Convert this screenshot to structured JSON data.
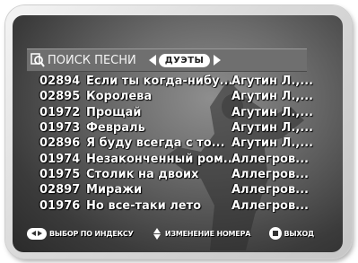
{
  "header": {
    "title": "ПОИСК ПЕСНИ",
    "mode": "ДУЭТЫ"
  },
  "songs": [
    {
      "number": "02894",
      "title": "Если ты когда-нибу...",
      "artist": "Агутин Л.,..."
    },
    {
      "number": "02895",
      "title": "Королева",
      "artist": "Агутин Л.,..."
    },
    {
      "number": "01972",
      "title": "Прощай",
      "artist": "Агутин Л.,..."
    },
    {
      "number": "01973",
      "title": "Февраль",
      "artist": "Агутин Л.,..."
    },
    {
      "number": "02896",
      "title": "Я буду всегда с то...",
      "artist": "Агутин Л.,..."
    },
    {
      "number": "01974",
      "title": "Незаконченный ром...",
      "artist": "Аллегров..."
    },
    {
      "number": "01975",
      "title": "Столик на двоих",
      "artist": "Аллегров..."
    },
    {
      "number": "02897",
      "title": "Миражи",
      "artist": "Аллегров..."
    },
    {
      "number": "01976",
      "title": "Но все-таки лето",
      "artist": "Аллегров..."
    }
  ],
  "footer": {
    "index_label": "ВЫБОР ПО ИНДЕКСУ",
    "number_label": "ИЗМЕНЕНИЕ НОМЕРА",
    "exit_label": "ВЫХОД"
  },
  "icons": {
    "search": "search-icon",
    "left_arrow": "left-arrow-icon",
    "right_arrow": "right-arrow-icon",
    "left_right": "left-right-icon",
    "up_down": "up-down-icon",
    "stop": "stop-icon"
  },
  "colors": {
    "text": "#ffffff",
    "header_bg": "#6f6f6f",
    "pill_bg": "#ffffff"
  }
}
